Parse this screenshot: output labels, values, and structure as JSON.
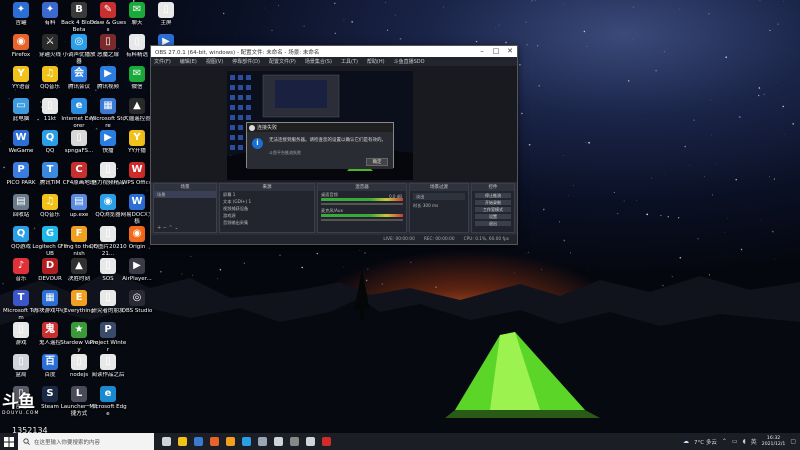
{
  "desktop_icons": [
    {
      "label": "吉罐",
      "color": "#2b6fd6",
      "glyph": "✦"
    },
    {
      "label": "Firefox",
      "color": "#e8632b",
      "glyph": "◉"
    },
    {
      "label": "YY语音",
      "color": "#f2c21b",
      "glyph": "Y"
    },
    {
      "label": "此电脑",
      "color": "#3d9be0",
      "glyph": "▭"
    },
    {
      "label": "WeGame",
      "color": "#2b6fd6",
      "glyph": "W"
    },
    {
      "label": "PICO PARK",
      "color": "#3a7de0",
      "glyph": "P"
    },
    {
      "label": "回收站",
      "color": "#6a7a8a",
      "glyph": "▤"
    },
    {
      "label": "QQ游戏",
      "color": "#2b9ee8",
      "glyph": "Q"
    },
    {
      "label": "音乐",
      "color": "#e0303a",
      "glyph": "♪"
    },
    {
      "label": "Microsoft Team",
      "color": "#3a56c8",
      "glyph": "T"
    },
    {
      "label": "游戏",
      "color": "#e8e8e8",
      "glyph": "▯"
    },
    {
      "label": "盒局",
      "color": "#d0d4da",
      "glyph": "▯"
    },
    {
      "label": "吉罐",
      "color": "#5a5a66",
      "glyph": "▯"
    },
    {
      "label": "有料",
      "color": "#3a6ad0",
      "glyph": "✦"
    },
    {
      "label": "穿越火线",
      "color": "#2a2a2a",
      "glyph": "⚔"
    },
    {
      "label": "QQ音乐",
      "color": "#f2c21b",
      "glyph": "♫"
    },
    {
      "label": "11kt",
      "color": "#e8e8e8",
      "glyph": "▯"
    },
    {
      "label": "QQ",
      "color": "#2b9ee8",
      "glyph": "Q"
    },
    {
      "label": "腾讯TIM",
      "color": "#3a8ae0",
      "glyph": "T"
    },
    {
      "label": "QQ音乐",
      "color": "#f2c21b",
      "glyph": "♫"
    },
    {
      "label": "Logitech G HUB",
      "color": "#1fb6e8",
      "glyph": "G"
    },
    {
      "label": "DEVOUR",
      "color": "#b02020",
      "glyph": "D"
    },
    {
      "label": "方块游戏中心",
      "color": "#2b6fd6",
      "glyph": "▦"
    },
    {
      "label": "鬼人遥控",
      "color": "#c83030",
      "glyph": "鬼"
    },
    {
      "label": "百度",
      "color": "#2b6fd6",
      "glyph": "百"
    },
    {
      "label": "Steam",
      "color": "#1a2a44",
      "glyph": "S"
    },
    {
      "label": "Back 4 Blood Beta",
      "color": "#3a3a3a",
      "glyph": "B"
    },
    {
      "label": "小调声优播放器",
      "color": "#2b9ee8",
      "glyph": "◎"
    },
    {
      "label": "腾讯会议",
      "color": "#2b7de0",
      "glyph": "会"
    },
    {
      "label": "Internet Explorer",
      "color": "#2b8ee0",
      "glyph": "e"
    },
    {
      "label": "spngaFS...",
      "color": "#d8d8d8",
      "glyph": "▯"
    },
    {
      "label": "CF4原画地理",
      "color": "#c83030",
      "glyph": "C"
    },
    {
      "label": "up.exe",
      "color": "#5a8ae0",
      "glyph": "▤"
    },
    {
      "label": "Fling to the Finish",
      "color": "#f0a020",
      "glyph": "F"
    },
    {
      "label": "决胜时刻",
      "color": "#303030",
      "glyph": "▲"
    },
    {
      "label": "Everything",
      "color": "#f2a020",
      "glyph": "E"
    },
    {
      "label": "Stardew Valley",
      "color": "#3a9a3a",
      "glyph": "★"
    },
    {
      "label": "nodejs",
      "color": "#e8e8e8",
      "glyph": "▯"
    },
    {
      "label": "Launcher一快捷方式",
      "color": "#4a4a58",
      "glyph": "L"
    },
    {
      "label": "Draw & Guess",
      "color": "#c83030",
      "glyph": "✎"
    },
    {
      "label": "恶魔之扉",
      "color": "#7a2a2a",
      "glyph": "▯"
    },
    {
      "label": "腾讯视频",
      "color": "#2b7de0",
      "glyph": "▶"
    },
    {
      "label": "Microsoft Store",
      "color": "#3a7ad0",
      "glyph": "▦"
    },
    {
      "label": "快播",
      "color": "#2b7de0",
      "glyph": "▶"
    },
    {
      "label": "魅力视频精品",
      "color": "#e8e8e8",
      "glyph": "▯"
    },
    {
      "label": "QQ浏览器",
      "color": "#2b9ee8",
      "glyph": "◉"
    },
    {
      "label": "QQ图片2021021...",
      "color": "#e8e8e8",
      "glyph": "▯"
    },
    {
      "label": "SOS",
      "color": "#e8e8e8",
      "glyph": "▯"
    },
    {
      "label": "研究者的朋友",
      "color": "#e8e8e8",
      "glyph": "▯"
    },
    {
      "label": "Project Winter",
      "color": "#3a4a6a",
      "glyph": "P"
    },
    {
      "label": "阅读作品之后",
      "color": "#e8e8e8",
      "glyph": "▯"
    },
    {
      "label": "Microsoft Edge",
      "color": "#1a8ad0",
      "glyph": "e"
    },
    {
      "label": "聊天",
      "color": "#1aaa3a",
      "glyph": "✉"
    },
    {
      "label": "有料精选",
      "color": "#e8e8e8",
      "glyph": "▯"
    },
    {
      "label": "微信",
      "color": "#1aaa3a",
      "glyph": "✉"
    },
    {
      "label": "大疆遥控器",
      "color": "#2a2a2a",
      "glyph": "▲"
    },
    {
      "label": "YY开播",
      "color": "#f2c21b",
      "glyph": "Y"
    },
    {
      "label": "WPS Office",
      "color": "#d02a2a",
      "glyph": "W"
    },
    {
      "label": "网易DOCX文档",
      "color": "#2b6fd6",
      "glyph": "W"
    },
    {
      "label": "Origin",
      "color": "#f26a1a",
      "glyph": "◉"
    },
    {
      "label": "AirPlayer...",
      "color": "#3a3a48",
      "glyph": "▶"
    },
    {
      "label": "OBS Studio",
      "color": "#2a2a36",
      "glyph": "◎"
    },
    {
      "label": "主屏",
      "color": "#e8e8e8",
      "glyph": "▯"
    },
    {
      "label": "最新视频",
      "color": "#2b6fd6",
      "glyph": "▶"
    },
    {
      "label": "QQ游戏",
      "color": "#2b9ee8",
      "glyph": "Q"
    },
    {
      "label": "dlicc8xcb...",
      "color": "#1aaa3a",
      "glyph": "▯"
    },
    {
      "label": "礼物.mp4",
      "color": "#d02a2a",
      "glyph": "▶"
    },
    {
      "label": "Garry's Mod",
      "color": "#2b6fd6",
      "glyph": "G"
    }
  ],
  "obs": {
    "title": "OBS 27.0.1 (64-bit, windows) - 配置文件: 未命名 - 场景: 未命名",
    "menu": [
      "文件(F)",
      "编辑(E)",
      "视图(V)",
      "停靠部件(D)",
      "配置文件(P)",
      "场景集合(S)",
      "工具(T)",
      "帮助(H)",
      "斗鱼直播SDO"
    ],
    "docks": {
      "scenes": {
        "header": "场景",
        "items": [
          "场景"
        ]
      },
      "sources": {
        "header": "来源",
        "items": [
          "屏幕 1",
          "文本 (GDI+) 1",
          "视频捕获设备",
          "游戏源",
          "音频输出采集"
        ]
      },
      "mixer": {
        "header": "混音器",
        "tracks": [
          "桌面音频",
          "麦克风/Aux"
        ],
        "level": "0.0 dB"
      },
      "transitions": {
        "header": "场景过渡",
        "type": "淡出",
        "duration_label": "时长",
        "duration": "300 ms"
      },
      "controls": {
        "header": "控件",
        "buttons": [
          "停止推流",
          "开始录制",
          "工作室模式",
          "设置",
          "退出"
        ]
      }
    },
    "status": {
      "live": "LIVE: 00:00:00",
      "rec": "REC: 00:00:00",
      "cpu": "CPU: 0.1%, 60.00 fps"
    }
  },
  "dialog": {
    "title": "连接失败",
    "message": "无法连接到服务器。请检查您的设置以确认它们是有效的。",
    "sub": "斗鱼平台推流失败",
    "ok": "确定"
  },
  "overlay": {
    "brand": "斗鱼",
    "brand_sub": "DOUYU.COM",
    "room": "1352134"
  },
  "taskbar": {
    "search_placeholder": "在这里输入你要搜索的内容",
    "weather": "7°C 多云",
    "time": "16:32",
    "date": "2021/12/1",
    "apps": [
      {
        "name": "task-view-icon",
        "color": "#cfd3da"
      },
      {
        "name": "file-explorer-icon",
        "color": "#f2c21b"
      },
      {
        "name": "mail-icon",
        "color": "#3a7ad0"
      },
      {
        "name": "firefox-icon",
        "color": "#e8632b"
      },
      {
        "name": "pin-app-icon",
        "color": "#f2a020"
      },
      {
        "name": "check-app-icon",
        "color": "#2b9ee8"
      },
      {
        "name": "steam-icon",
        "color": "#9aa6b8"
      },
      {
        "name": "obs-icon",
        "color": "#cfd3da"
      },
      {
        "name": "app-icon",
        "color": "#888888"
      },
      {
        "name": "game-icon",
        "color": "#cfd3da"
      },
      {
        "name": "netease-icon",
        "color": "#d02a2a"
      }
    ]
  }
}
